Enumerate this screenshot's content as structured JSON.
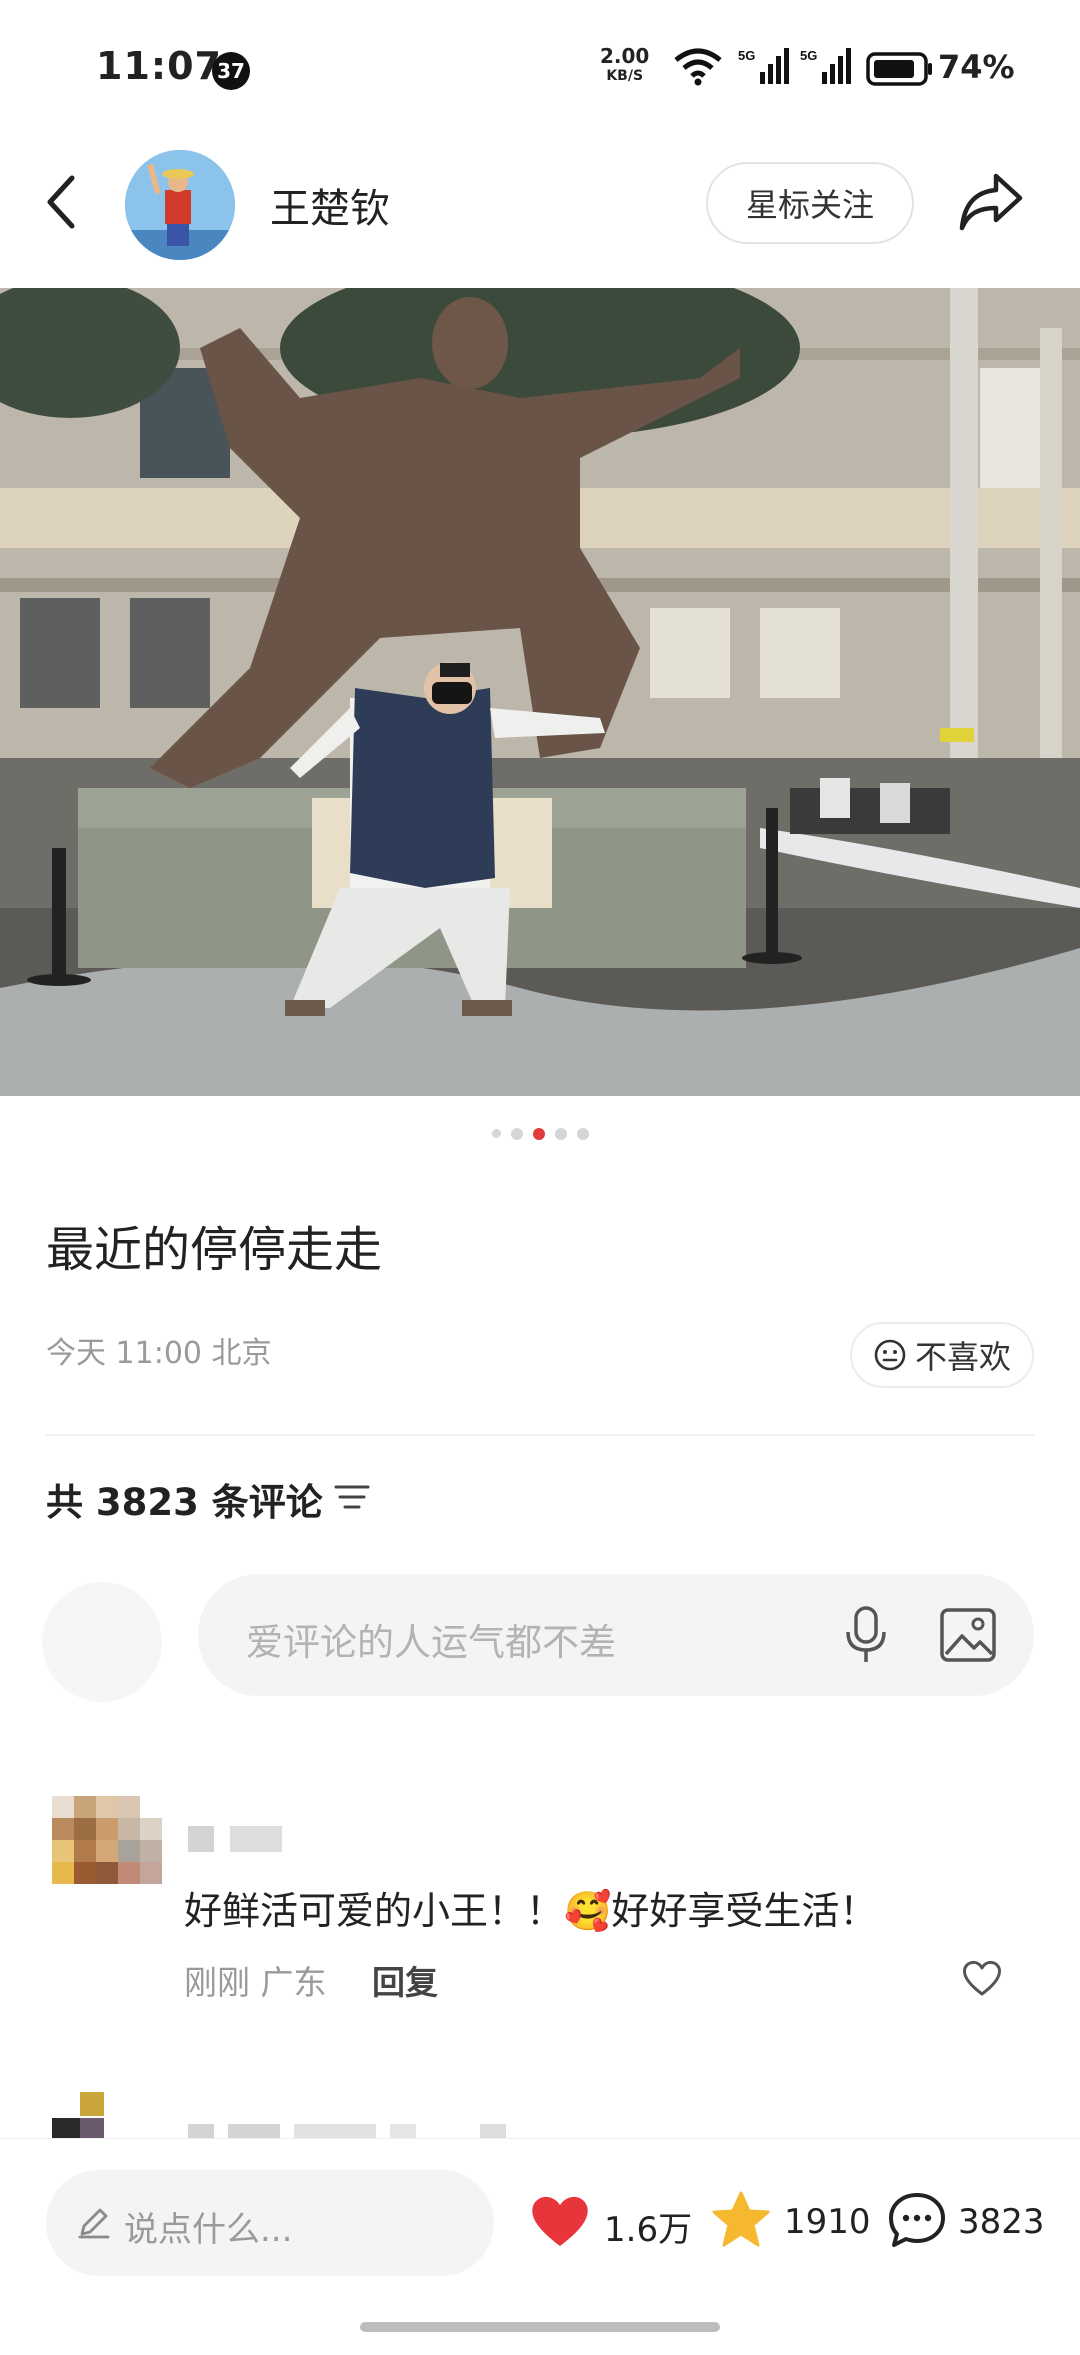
{
  "status_bar": {
    "time": "11:07",
    "notification_count": "37",
    "net_speed_value": "2.00",
    "net_speed_unit": "KB/S",
    "battery_percent": "74%"
  },
  "header": {
    "username": "王楚钦",
    "follow_button_label": "星标关注"
  },
  "carousel": {
    "total": 5,
    "active_index": 2
  },
  "post": {
    "title": "最近的停停走走",
    "meta": "今天 11:00 北京",
    "dislike_label": "不喜欢"
  },
  "comments_section": {
    "count_label": "共 3823 条评论",
    "input_placeholder": "爱评论的人运气都不差"
  },
  "comments": [
    {
      "text": "好鲜活可爱的小王！！🥰好好享受生活！",
      "time": "刚刚",
      "location": "广东",
      "reply_label": "回复"
    }
  ],
  "bottom_bar": {
    "input_placeholder": "说点什么...",
    "likes": "1.6万",
    "favorites": "1910",
    "comments": "3823"
  },
  "colors": {
    "accent_red": "#e84545",
    "star_yellow": "#f5b82e"
  }
}
